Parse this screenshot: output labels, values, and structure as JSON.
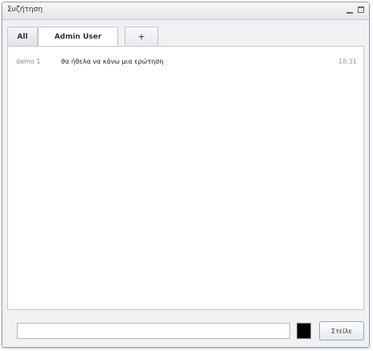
{
  "window": {
    "title": "Συζήτηση",
    "minimize_icon": "minimize-icon",
    "maximize_icon": "maximize-icon"
  },
  "tabs": [
    {
      "label": "All"
    },
    {
      "label": "Admin User"
    },
    {
      "label": "+"
    }
  ],
  "messages": [
    {
      "sender": "demo 1",
      "text": "θα ήθελα να κάνω μια ερώτηση",
      "time": "18:31"
    }
  ],
  "composer": {
    "value": "",
    "placeholder": "",
    "color": "#000000",
    "send_label": "Στείλε"
  }
}
